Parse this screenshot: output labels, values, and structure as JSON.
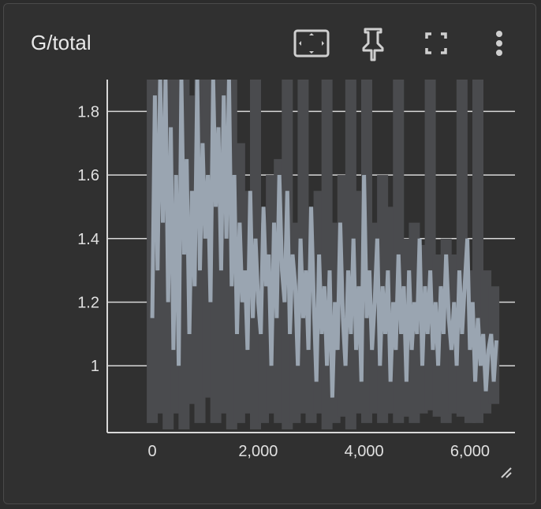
{
  "card": {
    "title": "G/total"
  },
  "toolbar": {
    "buttons": [
      {
        "name": "fit-to-data-icon"
      },
      {
        "name": "pin-icon"
      },
      {
        "name": "fullscreen-icon"
      },
      {
        "name": "more-vert-icon"
      }
    ]
  },
  "colors": {
    "background": "#303030",
    "raw_series": "#4a4b4e",
    "smoothed_series": "#9aa5b1",
    "grid": "#d8d8d8",
    "text": "#e0e0e0"
  },
  "chart_data": {
    "type": "line",
    "title": "G/total",
    "xlabel": "",
    "ylabel": "",
    "xlim": [
      -850,
      6850
    ],
    "ylim": [
      0.79,
      1.9
    ],
    "x_ticks": [
      0,
      2000,
      4000,
      6000
    ],
    "x_tick_labels": [
      "0",
      "2,000",
      "4,000",
      "6,000"
    ],
    "y_ticks": [
      1.0,
      1.2,
      1.4,
      1.6,
      1.8
    ],
    "y_tick_labels": [
      "1",
      "1.2",
      "1.4",
      "1.6",
      "1.8"
    ],
    "grid": true,
    "series": [
      {
        "role": "raw",
        "x": [
          0,
          150,
          300,
          450,
          600,
          750,
          900,
          1050,
          1200,
          1350,
          1500,
          1650,
          1800,
          1950,
          2100,
          2250,
          2400,
          2550,
          2700,
          2850,
          3000,
          3150,
          3300,
          3450,
          3600,
          3750,
          3900,
          4050,
          4200,
          4350,
          4500,
          4650,
          4800,
          4950,
          5100,
          5250,
          5400,
          5550,
          5700,
          5850,
          6000,
          6150,
          6300,
          6450
        ],
        "low": [
          0.82,
          0.85,
          0.8,
          0.85,
          0.8,
          0.88,
          0.82,
          0.9,
          0.82,
          0.85,
          0.8,
          0.82,
          0.85,
          0.8,
          0.82,
          0.85,
          0.82,
          0.8,
          0.82,
          0.85,
          0.82,
          0.85,
          0.8,
          0.82,
          0.84,
          0.8,
          0.85,
          0.82,
          0.85,
          0.82,
          0.85,
          0.82,
          0.84,
          0.82,
          0.85,
          0.86,
          0.84,
          0.82,
          0.85,
          0.84,
          0.82,
          0.82,
          0.85,
          0.88
        ],
        "high": [
          1.9,
          1.9,
          1.9,
          1.9,
          1.9,
          1.85,
          1.9,
          1.9,
          1.9,
          1.9,
          1.9,
          1.7,
          1.55,
          1.9,
          1.45,
          1.6,
          1.65,
          1.9,
          1.45,
          1.9,
          1.5,
          1.55,
          1.9,
          1.45,
          1.6,
          1.9,
          1.55,
          1.9,
          1.45,
          1.6,
          1.5,
          1.9,
          1.4,
          1.45,
          1.38,
          1.9,
          1.35,
          1.4,
          1.35,
          1.9,
          1.3,
          1.9,
          1.3,
          1.25
        ]
      },
      {
        "role": "smoothed",
        "x": [
          0,
          50,
          100,
          150,
          200,
          250,
          300,
          350,
          400,
          450,
          500,
          550,
          600,
          650,
          700,
          750,
          800,
          850,
          900,
          950,
          1000,
          1050,
          1100,
          1150,
          1200,
          1250,
          1300,
          1350,
          1400,
          1450,
          1500,
          1550,
          1600,
          1650,
          1700,
          1750,
          1800,
          1850,
          1900,
          1950,
          2000,
          2050,
          2100,
          2150,
          2200,
          2250,
          2300,
          2350,
          2400,
          2450,
          2500,
          2550,
          2600,
          2650,
          2700,
          2750,
          2800,
          2850,
          2900,
          2950,
          3000,
          3050,
          3100,
          3150,
          3200,
          3250,
          3300,
          3350,
          3400,
          3450,
          3500,
          3550,
          3600,
          3650,
          3700,
          3750,
          3800,
          3850,
          3900,
          3950,
          4000,
          4050,
          4100,
          4150,
          4200,
          4250,
          4300,
          4350,
          4400,
          4450,
          4500,
          4550,
          4600,
          4650,
          4700,
          4750,
          4800,
          4850,
          4900,
          4950,
          5000,
          5050,
          5100,
          5150,
          5200,
          5250,
          5300,
          5350,
          5400,
          5450,
          5500,
          5550,
          5600,
          5650,
          5700,
          5750,
          5800,
          5850,
          5900,
          5950,
          6000,
          6050,
          6100,
          6150,
          6200,
          6250,
          6300,
          6350,
          6400,
          6450,
          6500
        ],
        "y": [
          1.15,
          1.85,
          1.3,
          1.9,
          1.45,
          1.9,
          1.2,
          1.75,
          1.05,
          1.6,
          1.0,
          1.9,
          1.35,
          1.65,
          1.1,
          1.55,
          1.25,
          1.9,
          1.3,
          1.7,
          1.4,
          1.6,
          1.2,
          1.9,
          1.5,
          1.75,
          1.3,
          1.85,
          1.4,
          1.9,
          1.25,
          1.6,
          1.1,
          1.45,
          1.2,
          1.3,
          1.05,
          1.55,
          1.15,
          1.4,
          1.2,
          1.1,
          1.5,
          1.25,
          1.35,
          1.0,
          1.45,
          1.15,
          1.6,
          1.3,
          1.2,
          1.55,
          1.1,
          1.35,
          1.25,
          1.0,
          1.4,
          1.15,
          1.3,
          1.05,
          1.5,
          1.2,
          0.95,
          1.35,
          1.1,
          1.25,
          1.0,
          1.3,
          0.9,
          1.2,
          1.05,
          1.45,
          1.15,
          1.0,
          1.3,
          1.1,
          1.4,
          1.05,
          1.25,
          0.95,
          1.6,
          1.15,
          1.3,
          1.05,
          1.2,
          1.4,
          1.0,
          1.25,
          1.1,
          1.3,
          0.95,
          1.2,
          1.05,
          1.35,
          1.1,
          1.25,
          0.95,
          1.3,
          1.05,
          1.2,
          1.1,
          1.4,
          1.0,
          1.25,
          1.1,
          1.3,
          1.05,
          1.2,
          1.0,
          1.25,
          1.1,
          1.35,
          1.15,
          1.05,
          1.2,
          1.0,
          1.3,
          1.1,
          1.25,
          1.4,
          1.05,
          1.2,
          0.95,
          1.15,
          1.0,
          1.1,
          0.92,
          1.05,
          1.1,
          0.95,
          1.08
        ]
      }
    ]
  }
}
